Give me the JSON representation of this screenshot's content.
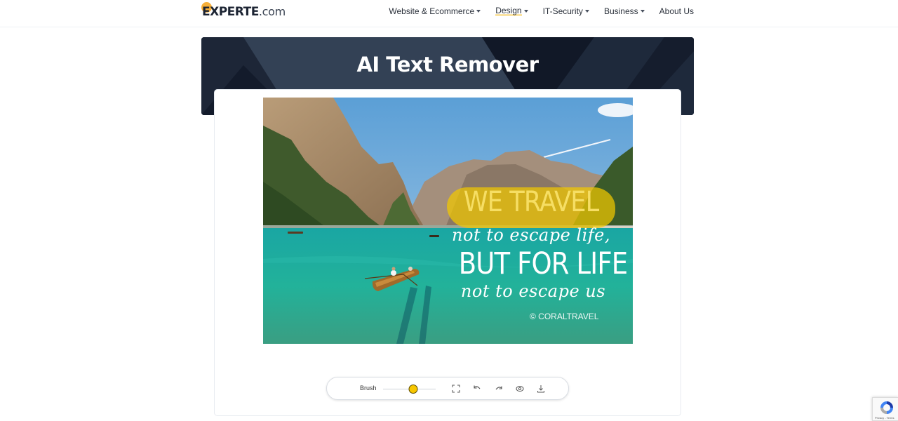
{
  "header": {
    "logo_main": "EXPERTE",
    "logo_tld": ".com",
    "brand_accent": "#f5a623",
    "nav": [
      {
        "label": "Website & Ecommerce",
        "has_dropdown": true,
        "active": false
      },
      {
        "label": "Design",
        "has_dropdown": true,
        "active": true
      },
      {
        "label": "IT-Security",
        "has_dropdown": true,
        "active": false
      },
      {
        "label": "Business",
        "has_dropdown": true,
        "active": false
      },
      {
        "label": "About Us",
        "has_dropdown": false,
        "active": false
      }
    ]
  },
  "banner": {
    "title": "AI Text Remover"
  },
  "editor": {
    "image": {
      "description": "Mountain lake with rowing boat and travel quote",
      "overlay_lines": [
        "WE TRAVEL",
        "not to escape life,",
        "BUT FOR LIFE",
        "not to escape us"
      ],
      "copyright": "© CORALTRAVEL",
      "mask_color": "#f1c800"
    },
    "toolbar": {
      "brush_label": "Brush",
      "brush_size_fraction": 0.57,
      "tools": [
        {
          "name": "fit-screen",
          "icon": "fullscreen-icon"
        },
        {
          "name": "undo",
          "icon": "undo-icon"
        },
        {
          "name": "redo",
          "icon": "redo-icon"
        },
        {
          "name": "preview",
          "icon": "eye-icon"
        },
        {
          "name": "download",
          "icon": "download-icon"
        }
      ]
    }
  },
  "recaptcha": {
    "label": "Privacy - Terms"
  },
  "colors": {
    "banner_dark": "#1a2333",
    "banner_light": "#334155",
    "slider_thumb": "#f7c600"
  }
}
